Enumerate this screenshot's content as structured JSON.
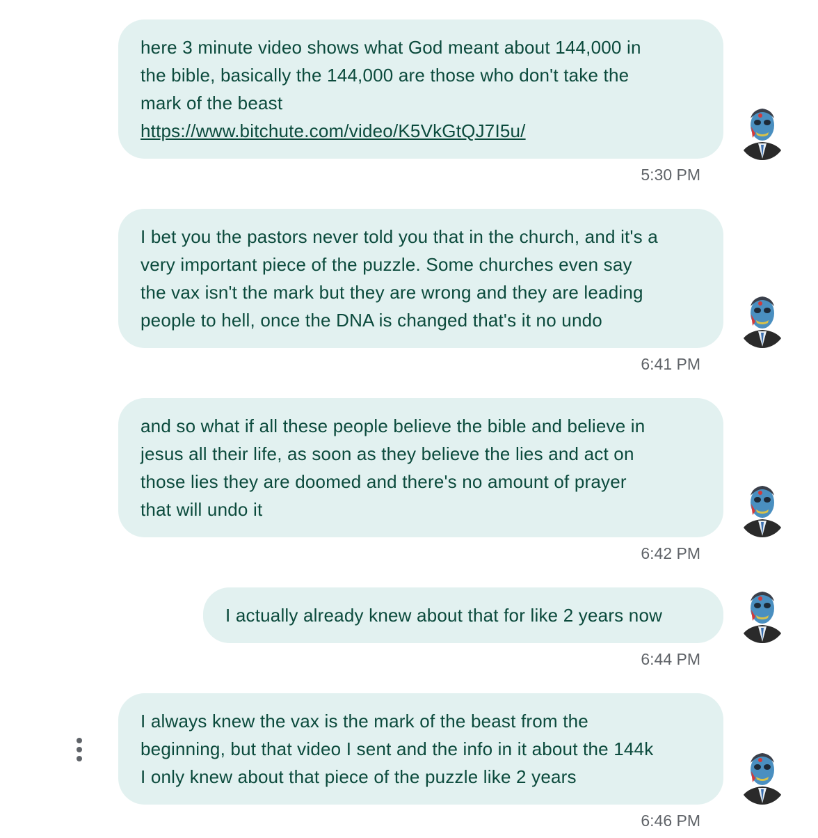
{
  "conversation": {
    "messages": [
      {
        "lines": [
          "here 3 minute video shows what God meant about 144,000 in",
          "the bible, basically the 144,000 are those who don't take the",
          "mark of the beast"
        ],
        "link": "https://www.bitchute.com/video/K5VkGtQJ7I5u/",
        "time": "5:30 PM"
      },
      {
        "lines": [
          "I bet you the pastors never told you that in the church, and it's a",
          "very important piece of the puzzle. Some churches even say",
          "the vax isn't the mark but they are wrong and they are leading",
          "people to hell, once the DNA is changed that's it no undo"
        ],
        "time": "6:41 PM"
      },
      {
        "lines": [
          "and so what if all these people believe the bible and believe in",
          "jesus all their life, as soon as they believe the lies and act on",
          "those lies they are doomed and there's no amount of prayer",
          "that will undo it"
        ],
        "time": "6:42 PM"
      },
      {
        "lines": [
          "I actually already knew about that for like 2 years now"
        ],
        "time": "6:44 PM"
      },
      {
        "lines": [
          "I always knew the vax is the mark of the beast from the",
          "beginning, but that video I sent and the info in it about the 144k",
          "I only knew about that piece of the puzzle like 2 years"
        ],
        "time": "6:46 PM"
      }
    ]
  },
  "colors": {
    "bubble_bg": "#e2f1f0",
    "bubble_text": "#0b4a3c",
    "timestamp": "#5f6368"
  },
  "icons": {
    "avatar": "avatar-image",
    "more": "more-vert-icon"
  }
}
